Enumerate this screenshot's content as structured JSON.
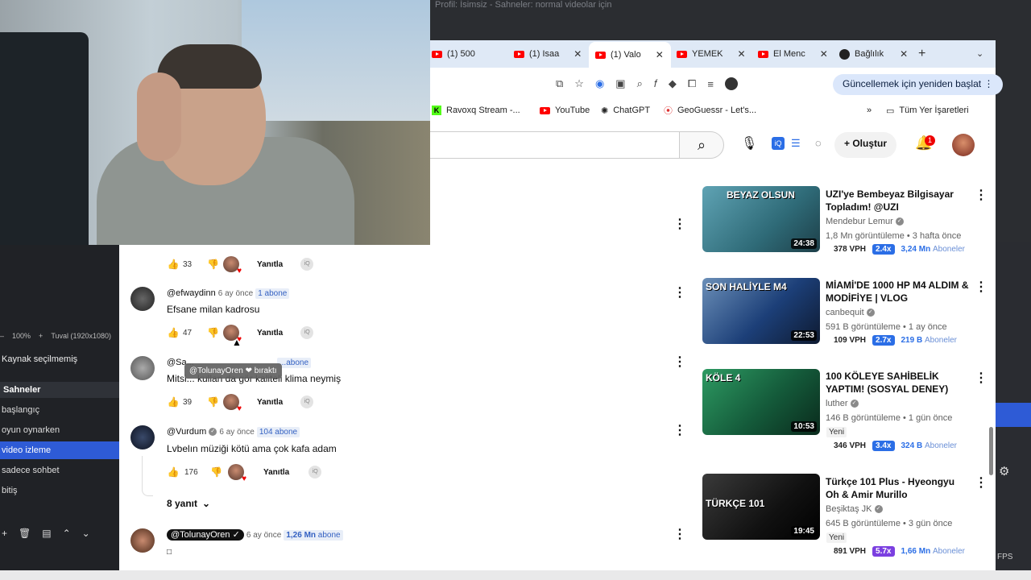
{
  "obs": {
    "window_title": "Profil: İsimsiz - Sahneler: normal videolar için",
    "zoom": "100%",
    "canvas": "Tuval (1920x1080)",
    "no_source": "Kaynak seçilmemiş",
    "scenes_label": "Sahneler",
    "scenes": [
      "başlangıç",
      "oyun oynarken",
      "video izleme",
      "sadece sohbet",
      "bitiş"
    ],
    "selected_scene": "video izleme",
    "fps": "FPS"
  },
  "browser": {
    "tabs": [
      {
        "label": "(1) 500",
        "icon": "youtube-icon"
      },
      {
        "label": "(1) Isaa",
        "icon": "youtube-icon"
      },
      {
        "label": "(1) Valo",
        "icon": "youtube-icon",
        "active": true
      },
      {
        "label": "YEMEK",
        "icon": "youtube-icon"
      },
      {
        "label": "El Menc",
        "icon": "youtube-icon"
      },
      {
        "label": "Bağlılık",
        "icon": "github-icon"
      }
    ],
    "update_button": "Güncellemek için yeniden başlat",
    "bookmarks": [
      "Ravoxq Stream -...",
      "YouTube",
      "ChatGPT",
      "GeoGuessr - Let's...",
      "Tüm Yer İşaretleri"
    ]
  },
  "youtube": {
    "create_label": "Oluştur",
    "notification_count": "1",
    "reply_label": "Yanıtla",
    "comments": [
      {
        "likes": "33"
      },
      {
        "author": "@efwaydinn",
        "time": "6 ay önce",
        "subs": "1 abone",
        "text": "Efsane milan kadrosu",
        "likes": "47"
      },
      {
        "author": "@Sa...",
        "time": "",
        "subs": "...abone",
        "text": "Mitsi... kullan da gör kaliteli klima neymiş",
        "likes": "39"
      },
      {
        "author": "@Vurdum",
        "time": "6 ay önce",
        "subs": "104 abone",
        "text": "Lvbelın müziği kötü ama çok kafa adam",
        "likes": "176"
      },
      {
        "author": "@TolunayOren",
        "time": "6 ay önce",
        "subs_num": "1,26 Mn",
        "subs_word": "abone",
        "text": "□"
      }
    ],
    "tooltip": "@TolunayOren ❤ bıraktı",
    "replies_toggle": "8 yanıt",
    "recommendations": [
      {
        "title": "UZI'ye Bembeyaz Bilgisayar Topladım! @UZI",
        "channel": "Mendebur Lemur",
        "meta": "1,8 Mn görüntüleme • 3 hafta önce",
        "duration": "24:38",
        "thumb_text": "BEYAZ OLSUN",
        "vph": "378 VPH",
        "mult": "2.4x",
        "subs_num": "3,24 Mn",
        "subs_word": "Aboneler",
        "thumb_color": "#4a8c9a"
      },
      {
        "title": "MİAMİ'DE 1000 HP M4 ALDIM & MODİFİYE | VLOG",
        "channel": "canbequit",
        "meta": "591 B görüntüleme • 1 ay önce",
        "duration": "22:53",
        "thumb_text": "SON HALİYLE M4",
        "vph": "109 VPH",
        "mult": "2.7x",
        "subs_num": "219 B",
        "subs_word": "Aboneler",
        "thumb_color": "#2a4f8a"
      },
      {
        "title": "100 KÖLEYE SAHİBELİK YAPTIM! (SOSYAL DENEY)",
        "channel": "luther",
        "meta": "146 B görüntüleme • 1 gün önce",
        "new": "Yeni",
        "duration": "10:53",
        "thumb_text": "KÖLE 4",
        "vph": "346 VPH",
        "mult": "3.4x",
        "subs_num": "324 B",
        "subs_word": "Aboneler",
        "thumb_color": "#1f7a4a"
      },
      {
        "title": "Türkçe 101 Plus - Hyeongyu Oh & Amir Murillo",
        "channel": "Beşiktaş JK",
        "meta": "645 B görüntüleme • 3 gün önce",
        "new": "Yeni",
        "duration": "19:45",
        "thumb_text": "TÜRKÇE 101",
        "vph": "891 VPH",
        "mult": "5.7x",
        "subs_num": "1,66 Mn",
        "subs_word": "Aboneler",
        "thumb_color": "#1a1a1a"
      }
    ]
  },
  "colors": {
    "accent": "#2b6ee6",
    "youtube_red": "#ff0000",
    "obs_selected": "#2e5bd6"
  }
}
